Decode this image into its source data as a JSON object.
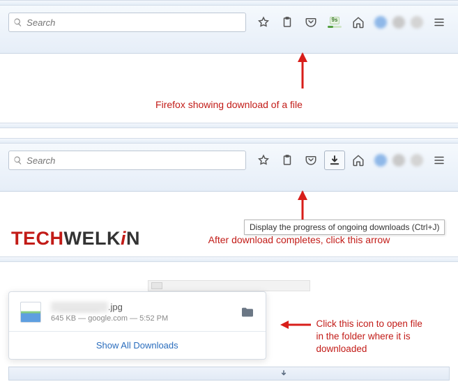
{
  "toolbar": {
    "search_placeholder": "Search",
    "download_progress_label": "9s"
  },
  "tooltip": {
    "downloads": "Display the progress of ongoing downloads (Ctrl+J)"
  },
  "captions": {
    "panel1": "Firefox showing download of a file",
    "panel2": "After download completes, click this arrow",
    "panel3_line1": "Click this icon to open file",
    "panel3_line2": "in the folder where it is downloaded"
  },
  "logo": {
    "part1": "TECH",
    "part2": "WELK",
    "part3": "i",
    "part4": "N"
  },
  "download_popover": {
    "file_ext": ".jpg",
    "file_meta": "645 KB — google.com — 5:52 PM",
    "show_all": "Show All Downloads"
  }
}
